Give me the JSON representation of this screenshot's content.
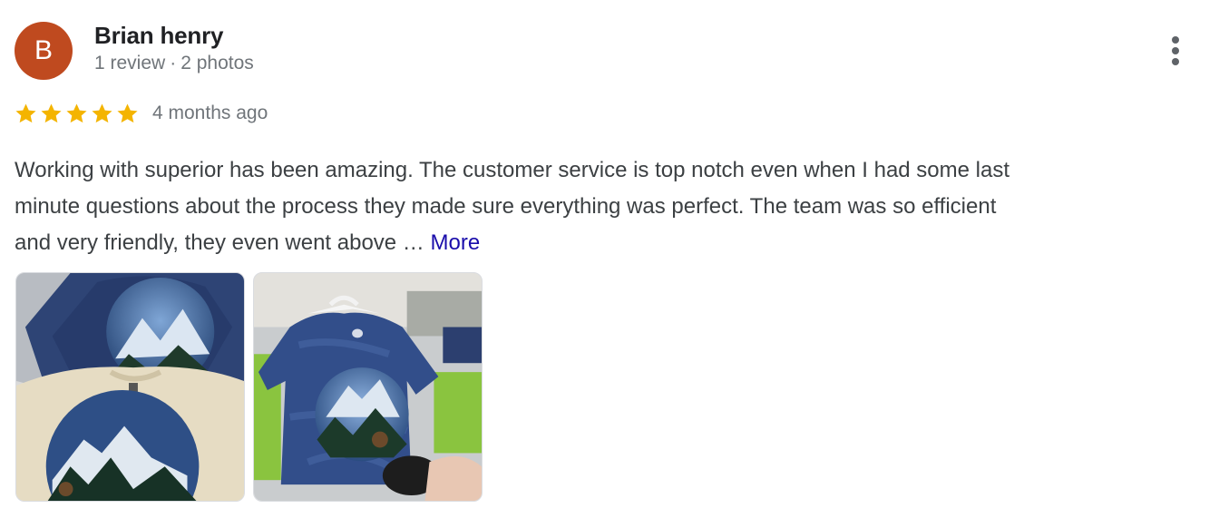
{
  "reviewer": {
    "initial": "B",
    "name": "Brian henry",
    "reviews": "1 review",
    "separator": "·",
    "photos": "2 photos",
    "avatar_color": "#bf4a1f"
  },
  "rating": {
    "stars": 5,
    "max": 5,
    "star_color": "#f4b400"
  },
  "time": "4 months ago",
  "review_text": {
    "line1": "Working with superior has been amazing. The customer service is top notch even when I had some last",
    "line2": "minute questions about the process they made sure everything was perfect. The team was so efficient",
    "line3": "and very friendly, they even went above …",
    "more": "More"
  },
  "photos": [
    {
      "name": "tie-dye-and-tan-shirts-photo"
    },
    {
      "name": "tie-dye-shirt-on-hanger-photo"
    }
  ],
  "icons": {
    "menu": "more-vert-icon",
    "star": "star-icon"
  }
}
